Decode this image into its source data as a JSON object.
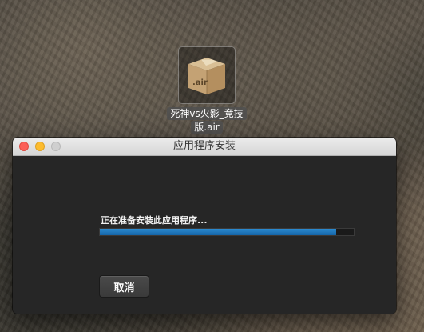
{
  "desktop": {
    "file": {
      "icon_text": ".air",
      "name_line1": "死神vs火影_竞技",
      "name_line2": "版.air",
      "icon": "package-box-icon"
    }
  },
  "window": {
    "title": "应用程序安装",
    "status_text": "正在准备安装此应用程序...",
    "progress": 0.93,
    "progress_color": "#1a78c2",
    "cancel_label": "取消"
  }
}
